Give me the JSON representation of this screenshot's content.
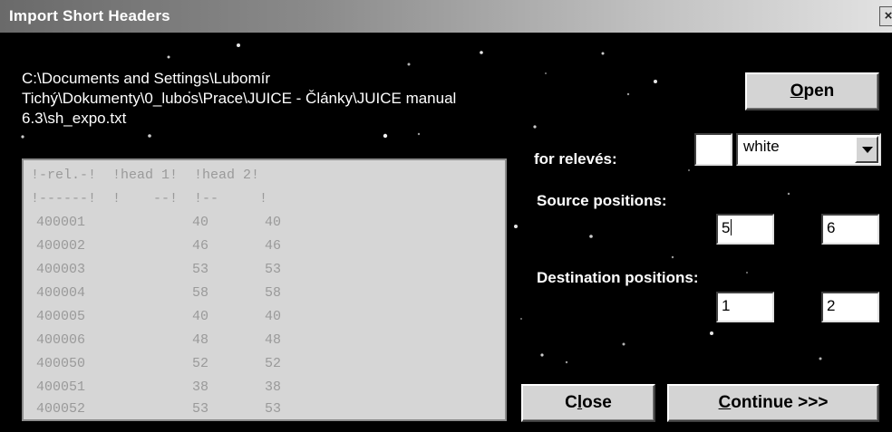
{
  "window": {
    "title": "Import Short Headers",
    "close_glyph": "×"
  },
  "file_path": {
    "line1": "C:\\Documents and Settings\\Lubomír",
    "line2": "Tichý\\Dokumenty\\0_lubos\\Prace\\JUICE - Články\\JUICE manual",
    "line3": "6.3\\sh_expo.txt"
  },
  "preview": {
    "header_line": "!-rel.-!  !head 1!  !head 2!",
    "separator_line": "!------!  !    --!  !--     !",
    "rows": [
      {
        "rel": "400001",
        "h1": "40",
        "h2": "40"
      },
      {
        "rel": "400002",
        "h1": "46",
        "h2": "46"
      },
      {
        "rel": "400003",
        "h1": "53",
        "h2": "53"
      },
      {
        "rel": "400004",
        "h1": "58",
        "h2": "58"
      },
      {
        "rel": "400005",
        "h1": "40",
        "h2": "40"
      },
      {
        "rel": "400006",
        "h1": "48",
        "h2": "48"
      },
      {
        "rel": "400050",
        "h1": "52",
        "h2": "52"
      },
      {
        "rel": "400051",
        "h1": "38",
        "h2": "38"
      },
      {
        "rel": "400052",
        "h1": "53",
        "h2": "53"
      }
    ]
  },
  "buttons": {
    "open": {
      "accel": "O",
      "rest": "pen"
    },
    "close": {
      "pre": "C",
      "accel": "l",
      "rest": "ose"
    },
    "continue": {
      "accel": "C",
      "rest": "ontinue >>>"
    }
  },
  "releves": {
    "label": "for relevés:",
    "color_value": "",
    "select_value": "white"
  },
  "source_positions": {
    "label": "Source positions:",
    "from": "5",
    "to": "6"
  },
  "destination_positions": {
    "label": "Destination positions:",
    "from": "1",
    "to": "2"
  },
  "icons": [
    "close-icon",
    "dropdown-arrow-icon"
  ],
  "colors": {
    "background": "#000000",
    "button_face": "#d4d4d4",
    "listbox_bg": "#d6d6d6",
    "listbox_text": "#9a9a9a"
  }
}
